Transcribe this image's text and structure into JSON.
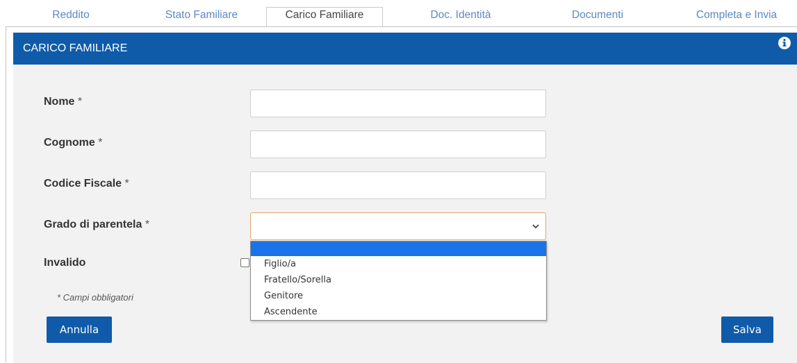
{
  "tabs": [
    {
      "label": "Reddito"
    },
    {
      "label": "Stato Familiare"
    },
    {
      "label": "Carico Familiare"
    },
    {
      "label": "Doc. Identità"
    },
    {
      "label": "Documenti"
    },
    {
      "label": "Completa e Invia"
    }
  ],
  "active_tab": "Carico Familiare",
  "panel": {
    "title": "CARICO FAMILIARE",
    "info_icon": "info-circle-icon"
  },
  "form": {
    "required_mark": "*",
    "fields": {
      "nome": {
        "label": "Nome",
        "value": ""
      },
      "cognome": {
        "label": "Cognome",
        "value": ""
      },
      "codice_fiscale": {
        "label": "Codice Fiscale",
        "value": ""
      },
      "grado": {
        "label": "Grado di parentela",
        "selected": ""
      },
      "invalido": {
        "label": "Invalido",
        "checked": false
      }
    },
    "grado_options": [
      "",
      "Figlio/a",
      "Fratello/Sorella",
      "Genitore",
      "Ascendente"
    ],
    "required_note": "* Campi obbligatori"
  },
  "buttons": {
    "annulla": "Annulla",
    "salva": "Salva"
  },
  "colors": {
    "brand": "#0f5baa",
    "tab_text": "#5b8ac4",
    "dropdown_highlight": "#1a73e8",
    "panel_bg": "#f2f2f2"
  }
}
